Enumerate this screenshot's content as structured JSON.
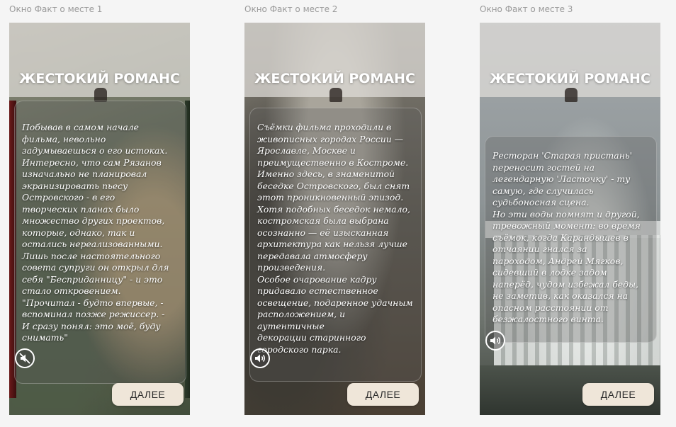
{
  "frames": [
    {
      "label": "Окно Факт о месте 1",
      "title": "ЖЕСТОКИЙ РОМАНС",
      "text": "Побывав в самом начале\nфильма, невольно\nзадумываешься о его истоках.\nИнтересно, что сам Рязанов\nизначально не планировал\nэкранизировать пьесу\nОстровского - в его\nтворческих планах было\nмножество других проектов,\nкоторые, однако, так и\nостались нереализованными.\nЛишь после настоятельного\nсовета супруги он открыл для\nсебя \"Бесприданницу\" - и это\nстало откровением.\n\"Прочитал - будто впервые, -\nвспоминал позже режиссер. -\nИ сразу понял: это моё, буду\nснимать\"",
      "sound_icon": "sound-muted-icon",
      "next_label": "ДАЛЕЕ"
    },
    {
      "label": "Окно Факт о месте 2",
      "title": "ЖЕСТОКИЙ РОМАНС",
      "text": "Съёмки фильма проходили в\nживописных городах России —\nЯрославле, Москве и\nпреимущественно в Костроме.\nИменно здесь, в знаменитой\nбеседке Островского, был снят\nэтот проникновенный эпизод.\nХотя подобных беседок немало,\nкостромская была выбрана\nосознанно — её изысканная\nархитектура как нельзя лучше\nпередавала атмосферу\nпроизведения.\nОсобое очарование кадру\nпридавало естественное\nосвещение, подаренное удачным\nрасположением, и аутентичные\nдекорации старинного\nгородского парка.",
      "sound_icon": "sound-on-icon",
      "next_label": "ДАЛЕЕ"
    },
    {
      "label": "Окно Факт о месте 3",
      "title": "ЖЕСТОКИЙ РОМАНС",
      "text": "Ресторан 'Старая пристань'\nпереносит гостей на\nлегендарную 'Ласточку' - ту\nсамую, где случилась\nсудьбоносная сцена.\nНо эти воды помнят и другой,\nтревожный момент: во время\nсъёмок, когда Карандышев в\nотчаянии гнался за\nпароходом, Андрей Мягков,\nсидевший в лодке задом\nнаперёд, чудом избежал беды,\nне заметив, как оказался на\nопасном расстоянии от\nбезжалостного винта.",
      "sound_icon": "sound-on-icon",
      "next_label": "ДАЛЕЕ"
    }
  ]
}
